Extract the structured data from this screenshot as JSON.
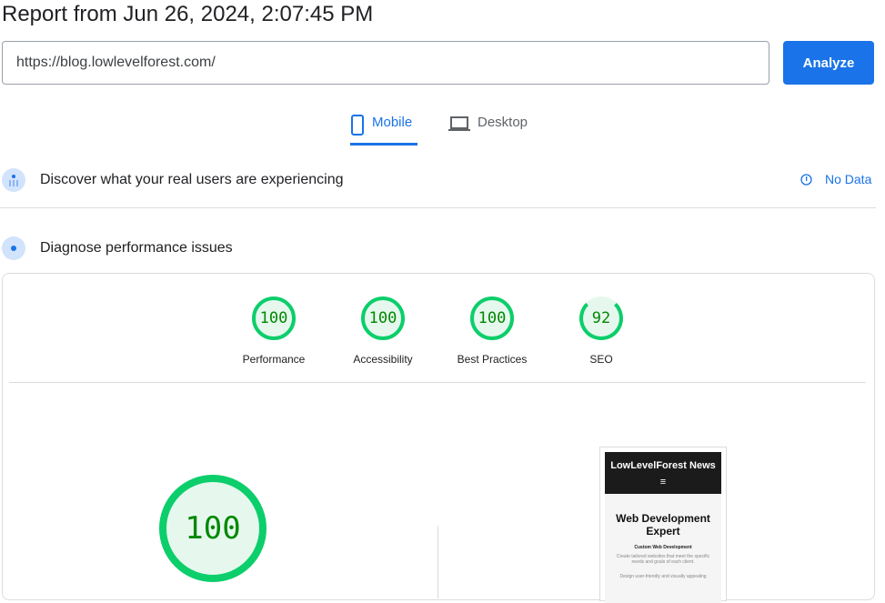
{
  "title": "Report from Jun 26, 2024, 2:07:45 PM",
  "url_input": {
    "value": "https://blog.lowlevelforest.com/"
  },
  "analyze_label": "Analyze",
  "tabs": [
    {
      "label": "Mobile",
      "icon": "smartphone-icon",
      "selected": true
    },
    {
      "label": "Desktop",
      "icon": "laptop-icon",
      "selected": false
    }
  ],
  "field_data": {
    "heading": "Discover what your real users are experiencing",
    "status": "No Data",
    "icon": "info-icon"
  },
  "lab": {
    "heading": "Diagnose performance issues"
  },
  "scores": [
    {
      "label": "Performance",
      "value": "100"
    },
    {
      "label": "Accessibility",
      "value": "100"
    },
    {
      "label": "Best Practices",
      "value": "100"
    },
    {
      "label": "SEO",
      "value": "92"
    }
  ],
  "big_score": "100",
  "colors": {
    "pass": "#0cce6b",
    "accent": "#1a73e8"
  },
  "screenshot": {
    "site_title": "LowLevelForest News",
    "menu": "≡",
    "headline": "Web Development Expert",
    "subhead": "Custom Web Development",
    "text1": "Create tailored websites that meet the specific needs and goals of each client.",
    "text2": "Design user-friendly and visually appealing"
  }
}
